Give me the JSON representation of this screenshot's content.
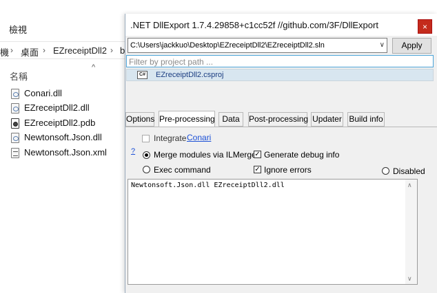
{
  "explorer": {
    "view_label": "檢視",
    "breadcrumb": [
      "機",
      "桌面",
      "EZreceiptDll2",
      "b"
    ],
    "column_header": "名稱",
    "files": [
      {
        "name": "Conari.dll",
        "icon": "dll-file-icon"
      },
      {
        "name": "EZreceiptDll2.dll",
        "icon": "dll-file-icon"
      },
      {
        "name": "EZreceiptDll2.pdb",
        "icon": "pdb-file-icon"
      },
      {
        "name": "Newtonsoft.Json.dll",
        "icon": "dll-file-icon"
      },
      {
        "name": "Newtonsoft.Json.xml",
        "icon": "xml-file-icon"
      }
    ]
  },
  "dialog": {
    "title": ".NET DllExport 1.7.4.29858+c1cc52f //github.com/3F/DllExport",
    "close_label": "×",
    "solution_path": "C:\\Users\\jackkuo\\Desktop\\EZreceiptDll2\\EZreceiptDll2.sln",
    "apply_label": "Apply",
    "filter_placeholder": "Filter by project path ...",
    "project_icon_text": "C#",
    "project_name": "EZreceiptDll2.csproj",
    "tabs": [
      "Options",
      "Pre-processing",
      "Data",
      "Post-processing",
      "Updater",
      "Build info"
    ],
    "active_tab": "Pre-processing",
    "integrate_label": "Integrate",
    "integrate_link": "Conari",
    "help_mark": "?",
    "merge_label": "Merge modules via ILMerge",
    "debug_label": "Generate debug info",
    "exec_label": "Exec command",
    "ignore_label": "Ignore errors",
    "disabled_label": "Disabled",
    "command_text": "Newtonsoft.Json.dll EZreceiptDll2.dll",
    "check_mark": "✓"
  }
}
